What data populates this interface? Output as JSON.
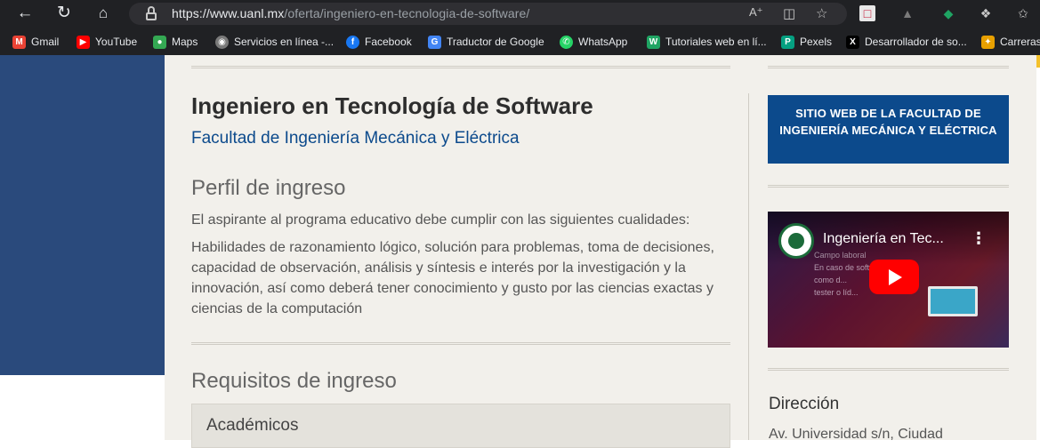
{
  "browser": {
    "url_host": "https://www.uanl.mx",
    "url_path": "/oferta/ingeniero-en-tecnologia-de-software/",
    "nav_icons": [
      "back-arrow-icon",
      "reload-icon",
      "home-icon",
      "lock-icon"
    ],
    "toolbar_icons": [
      "read-aloud-icon",
      "split-screen-icon",
      "add-favorite-icon",
      "extension-icons",
      "extensions-icon",
      "favorites-icon"
    ]
  },
  "bookmarks": [
    {
      "label": "Gmail",
      "icon": "gmail-icon",
      "color": "#ea4335"
    },
    {
      "label": "YouTube",
      "icon": "youtube-icon",
      "color": "#ff0000"
    },
    {
      "label": "Maps",
      "icon": "maps-icon",
      "color": "#34a853"
    },
    {
      "label": "Servicios en línea -...",
      "icon": "servicios-icon",
      "color": "#7a7a7a"
    },
    {
      "label": "Facebook",
      "icon": "facebook-icon",
      "color": "#1877f2"
    },
    {
      "label": "Traductor de Google",
      "icon": "translate-icon",
      "color": "#4285f4"
    },
    {
      "label": "WhatsApp",
      "icon": "whatsapp-icon",
      "color": "#25d366"
    },
    {
      "label": "Tutoriales web en lí...",
      "icon": "tutoriales-icon",
      "color": "#1fa463"
    },
    {
      "label": "Pexels",
      "icon": "pexels-icon",
      "color": "#05a081"
    },
    {
      "label": "Desarrollador de so...",
      "icon": "x-icon",
      "color": "#000000"
    },
    {
      "label": "Carreras",
      "icon": "carreras-icon",
      "color": "#e8a000"
    }
  ],
  "main": {
    "title": "Ingeniero en Tecnología de Software",
    "faculty": "Facultad de Ingeniería Mecánica y Eléctrica",
    "perfil_heading": "Perfil de ingreso",
    "perfil_intro": "El aspirante al programa educativo debe cumplir con las siguientes cualidades:",
    "perfil_body": "Habilidades de razonamiento lógico, solución para problemas, toma de decisiones, capacidad de observación, análisis y síntesis e interés por la investigación y la innovación, así como deberá tener conocimiento y gusto por las ciencias exactas y ciencias de la computación",
    "requisitos_heading": "Requisitos de ingreso",
    "academicos_label": "Académicos"
  },
  "sidebar": {
    "sitio_button": "SITIO WEB DE LA FACULTAD DE INGENIERÍA MECÁNICA Y ELÉCTRICA",
    "video_title": "Ingeniería en Tec...",
    "direccion_heading": "Dirección",
    "direccion_text": "Av. Universidad s/n, Ciudad"
  },
  "colors": {
    "brand_blue": "#0c4a8c",
    "panel_blue": "#2a4a7c",
    "gold": "#f4c12b",
    "page_bg": "#f2f0eb"
  }
}
